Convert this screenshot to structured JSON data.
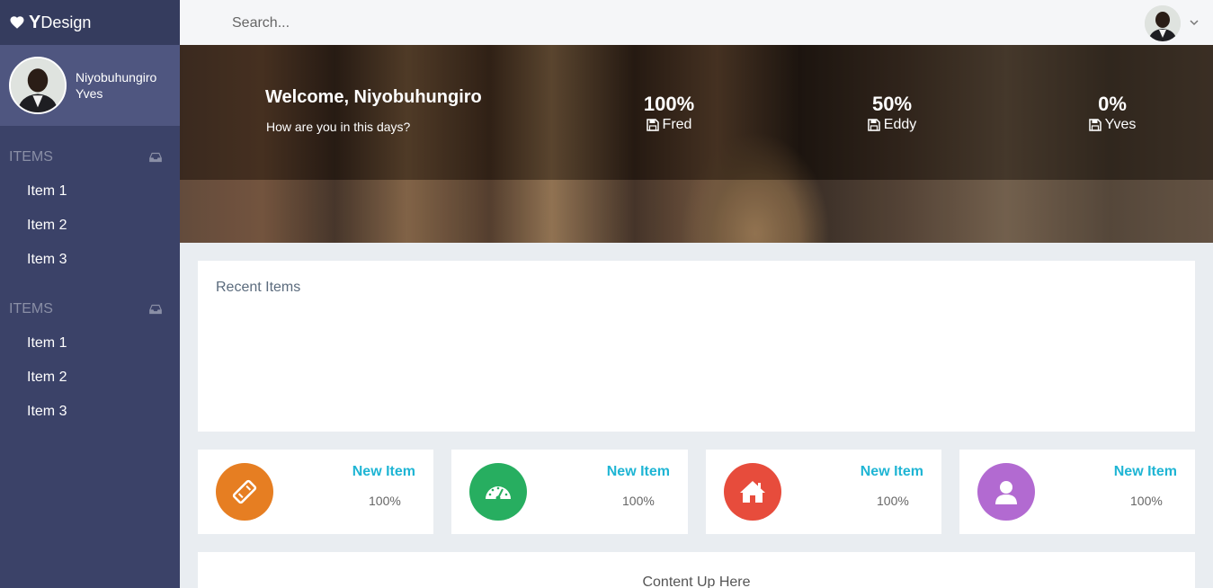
{
  "brand": {
    "icon": "heart-icon",
    "y": "Y",
    "rest": "Design"
  },
  "profile": {
    "first": "Niyobuhungiro",
    "last": "Yves"
  },
  "sidebar": {
    "sections": [
      {
        "title": "ITEMS",
        "icon": "inbox-tray-icon",
        "items": [
          "Item 1",
          "Item 2",
          "Item 3"
        ]
      },
      {
        "title": "ITEMS",
        "icon": "inbox-tray-icon",
        "items": [
          "Item 1",
          "Item 2",
          "Item 3"
        ]
      }
    ]
  },
  "topbar": {
    "search_placeholder": "Search..."
  },
  "hero": {
    "welcome": "Welcome, Niyobuhungiro",
    "subtitle": "How are you in this days?",
    "stats": [
      {
        "value": "100%",
        "name": "Fred"
      },
      {
        "value": "50%",
        "name": "Eddy"
      },
      {
        "value": "0%",
        "name": "Yves"
      }
    ]
  },
  "recent": {
    "title": "Recent Items"
  },
  "cards": [
    {
      "title": "New Item",
      "value": "100%",
      "icon": "ticket-icon",
      "color": "#e67e22"
    },
    {
      "title": "New Item",
      "value": "100%",
      "icon": "dashboard-gauge-icon",
      "color": "#27ae60"
    },
    {
      "title": "New Item",
      "value": "100%",
      "icon": "home-icon",
      "color": "#e74c3c"
    },
    {
      "title": "New Item",
      "value": "100%",
      "icon": "user-icon",
      "color": "#b26ad1"
    }
  ],
  "bottom": {
    "text": "Content Up Here"
  },
  "colors": {
    "sidebar": "#3b4268",
    "accent": "#1fb5d4"
  }
}
